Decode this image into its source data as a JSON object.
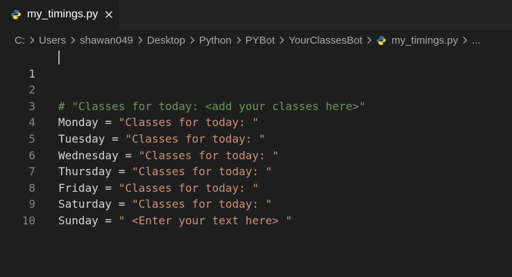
{
  "tab": {
    "filename": "my_timings.py",
    "icon": "python-file-icon",
    "close_icon": "close-icon"
  },
  "breadcrumb": {
    "items": [
      "C:",
      "Users",
      "shawan049",
      "Desktop",
      "Python",
      "PYBot",
      "YourClassesBot"
    ],
    "file": "my_timings.py",
    "more": "..."
  },
  "code": {
    "lines": [
      {
        "num": "1",
        "comment": "# \"Classes for today: <add your classes here>\""
      },
      {
        "num": "2"
      },
      {
        "num": "3",
        "var": "Monday",
        "op": " = ",
        "str": "\"Classes for today: \""
      },
      {
        "num": "4",
        "var": "Tuesday",
        "op": " = ",
        "str": "\"Classes for today: \""
      },
      {
        "num": "5",
        "var": "Wednesday",
        "op": " = ",
        "str": "\"Classes for today: \""
      },
      {
        "num": "6",
        "var": "Thursday",
        "op": " = ",
        "str": "\"Classes for today: \""
      },
      {
        "num": "7",
        "var": "Friday",
        "op": " = ",
        "str": "\"Classes for today: \""
      },
      {
        "num": "8",
        "var": "Saturday",
        "op": " = ",
        "str": "\"Classes for today: \""
      },
      {
        "num": "9",
        "var": "Sunday",
        "op": " = ",
        "str": "\" <Enter your text here> \""
      },
      {
        "num": "10"
      }
    ]
  },
  "colors": {
    "background": "#1e1e1e",
    "tabbar": "#252526",
    "comment": "#6a9955",
    "string": "#ce9178",
    "identifier": "#d4d4d4",
    "line_number": "#858585",
    "python_blue": "#3572a5",
    "python_yellow": "#ffd43b"
  }
}
